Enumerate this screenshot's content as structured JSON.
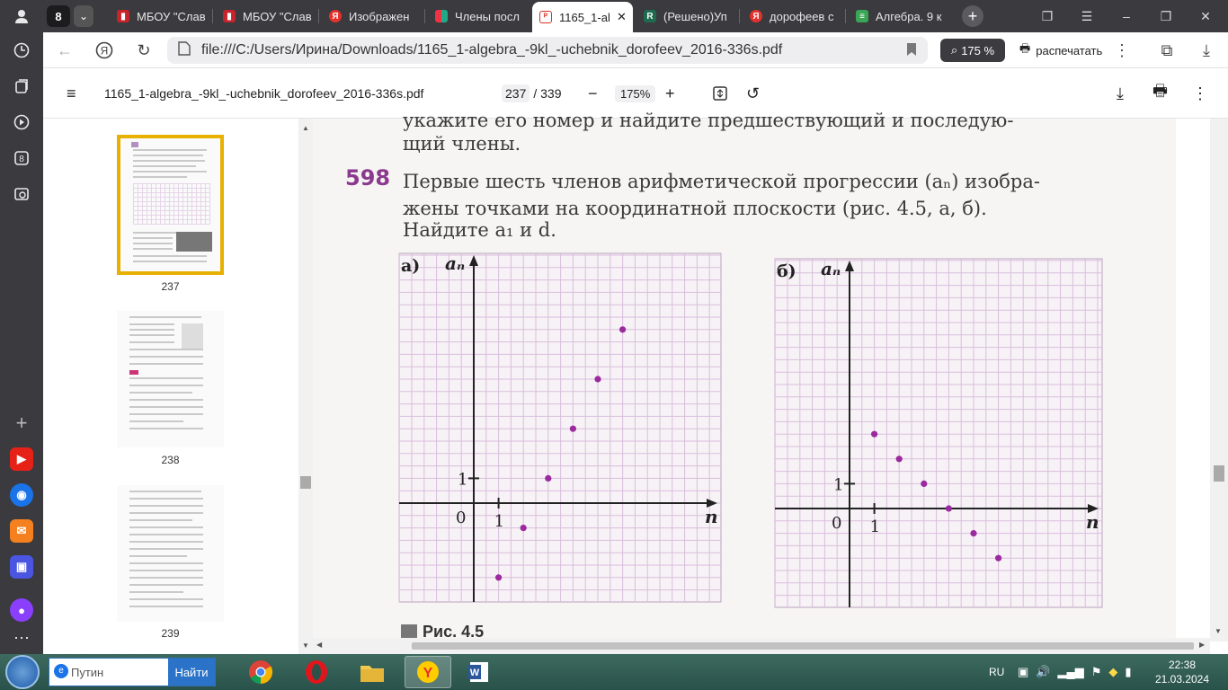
{
  "browser": {
    "tab_count_badge": "8",
    "tabs": [
      {
        "label": "МБОУ \"Слав",
        "icon": "bookmark-red-icon",
        "color": "#c8242b"
      },
      {
        "label": "МБОУ \"Слав",
        "icon": "bookmark-red-icon",
        "color": "#c8242b"
      },
      {
        "label": "Изображен",
        "icon": "yandex-icon",
        "color": "#e4312b"
      },
      {
        "label": "Члены посл",
        "icon": "grid-icon",
        "color": "#2f8f4e"
      },
      {
        "label": "1165_1-al",
        "icon": "pdf-icon",
        "color": "#d93025",
        "active": true
      },
      {
        "label": "(Решено)Уп",
        "icon": "znanija-icon",
        "color": "#1f6b4f"
      },
      {
        "label": "дорофеев с",
        "icon": "yandex-icon",
        "color": "#e4312b"
      },
      {
        "label": "Алгебра. 9 к",
        "icon": "book-icon",
        "color": "#3aa655"
      }
    ],
    "address": "file:///C:/Users/Ирина/Downloads/1165_1-algebra_-9kl_-uchebnik_dorofeev_2016-336s.pdf",
    "zoom_pill": "175 %",
    "print_label": "распечатать"
  },
  "sidebar": {
    "items": [
      {
        "name": "profile-icon",
        "glyph": "👤"
      },
      {
        "name": "history-icon",
        "glyph": "🕘"
      },
      {
        "name": "collections-icon",
        "glyph": "❐"
      },
      {
        "name": "video-icon",
        "glyph": "▶"
      },
      {
        "name": "badge-8-icon",
        "glyph": "8"
      },
      {
        "name": "screenshot-icon",
        "glyph": "📷"
      },
      {
        "name": "add-icon",
        "glyph": "+"
      },
      {
        "name": "youtube-icon",
        "glyph": "▶",
        "color": "#e62117"
      },
      {
        "name": "browser-app-icon",
        "glyph": "◉",
        "color": "#1a73e8"
      },
      {
        "name": "mail-icon",
        "glyph": "✉",
        "color": "#f4801f"
      },
      {
        "name": "messenger-icon",
        "glyph": "▣",
        "color": "#4a56e2"
      },
      {
        "name": "alice-icon",
        "glyph": "●",
        "color": "#8a3ffc"
      },
      {
        "name": "more-icon",
        "glyph": "⋯"
      }
    ]
  },
  "pdf": {
    "filename": "1165_1-algebra_-9kl_-uchebnik_dorofeev_2016-336s.pdf",
    "current_page": "237",
    "total_pages": "/ 339",
    "zoom": "175%",
    "thumbnails": [
      {
        "label": "237",
        "selected": true
      },
      {
        "label": "238",
        "selected": false
      },
      {
        "label": "239",
        "selected": false
      }
    ]
  },
  "document": {
    "top_line_1": "укажите его номер и найдите предшествующий и последую-",
    "top_line_2": "щий члены.",
    "problem_number": "598",
    "problem_line_1": "Первые шесть членов арифметической прогрессии (aₙ) изобра-",
    "problem_line_2": "жены точками на координатной плоскости (рис. 4.5, а, б).",
    "problem_line_3": "Найдите a₁ и d.",
    "figure_caption": "Рис. 4.5"
  },
  "chart_data": [
    {
      "type": "scatter",
      "panel_label": "а)",
      "xlabel": "n",
      "ylabel": "aₙ",
      "origin_label": "0",
      "x_tick_label": "1",
      "y_tick_label": "1",
      "grid": true,
      "x": [
        1,
        2,
        3,
        4,
        5,
        6
      ],
      "y": [
        -3,
        -1,
        1,
        3,
        5,
        7
      ]
    },
    {
      "type": "scatter",
      "panel_label": "б)",
      "xlabel": "n",
      "ylabel": "aₙ",
      "origin_label": "0",
      "x_tick_label": "1",
      "y_tick_label": "1",
      "grid": true,
      "x": [
        1,
        2,
        3,
        4,
        5,
        6
      ],
      "y": [
        3,
        2,
        1,
        0,
        -1,
        -2
      ]
    }
  ],
  "taskbar": {
    "search_placeholder": "Путин",
    "search_button": "Найти",
    "language": "RU",
    "time": "22:38",
    "date": "21.03.2024",
    "apps": [
      {
        "name": "chrome-icon"
      },
      {
        "name": "opera-icon"
      },
      {
        "name": "explorer-icon"
      },
      {
        "name": "yandex-browser-icon",
        "active": true
      },
      {
        "name": "word-icon"
      }
    ]
  }
}
